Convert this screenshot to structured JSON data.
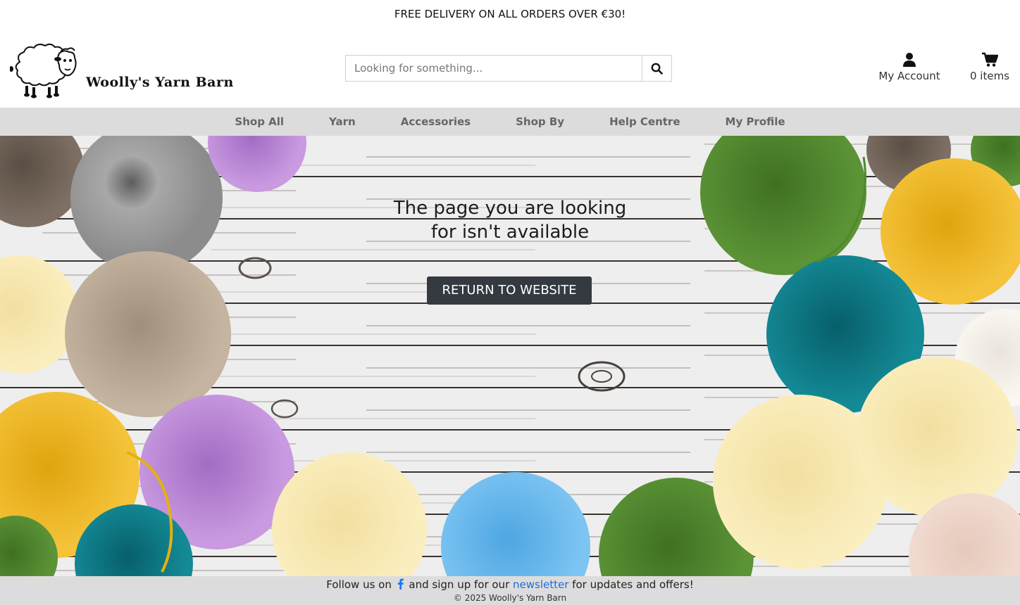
{
  "banner": {
    "text": "FREE DELIVERY ON ALL ORDERS OVER €30!"
  },
  "header": {
    "logo_text": "Woolly's Yarn Barn",
    "search": {
      "placeholder": "Looking for something...",
      "value": ""
    },
    "account_label": "My Account",
    "cart_label": "0 items"
  },
  "nav": {
    "items": [
      {
        "label": "Shop All"
      },
      {
        "label": "Yarn"
      },
      {
        "label": "Accessories"
      },
      {
        "label": "Shop By"
      },
      {
        "label": "Help Centre"
      },
      {
        "label": "My Profile"
      }
    ]
  },
  "hero": {
    "message_line1": "The page you are looking",
    "message_line2": "for isn't available",
    "button_label": "RETURN TO WEBSITE"
  },
  "footer": {
    "follow_prefix": "Follow us on",
    "follow_middle": "and sign up for our",
    "newsletter_link": "newsletter",
    "follow_suffix": "for updates and offers!",
    "copyright": "© 2025 Woolly's Yarn Barn"
  },
  "colors": {
    "nav_bg": "#dcdcdc",
    "button_bg": "#343a40",
    "link": "#1a6fd8",
    "facebook": "#1877f2"
  },
  "icons": [
    "sheep-logo-icon",
    "search-icon",
    "user-icon",
    "cart-icon",
    "facebook-icon"
  ]
}
